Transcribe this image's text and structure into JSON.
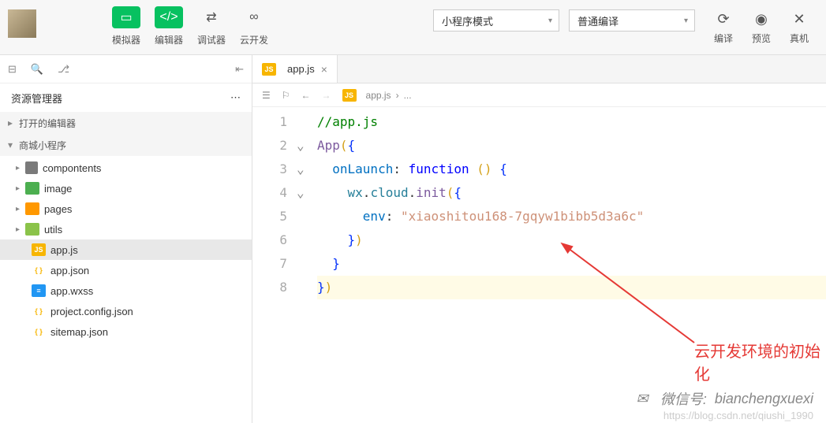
{
  "toolbar": {
    "simulator": "模拟器",
    "editor": "编辑器",
    "debugger": "调试器",
    "cloud": "云开发",
    "mode_dropdown": "小程序模式",
    "compile_dropdown": "普通编译",
    "compile": "编译",
    "preview": "预览",
    "device": "真机"
  },
  "sidebar": {
    "title": "资源管理器",
    "open_editors": "打开的编辑器",
    "project_name": "商城小程序",
    "tree": [
      {
        "name": "compontents",
        "type": "folder",
        "cls": "folder-icon"
      },
      {
        "name": "image",
        "type": "folder",
        "cls": "folder-green"
      },
      {
        "name": "pages",
        "type": "folder",
        "cls": "folder-orange"
      },
      {
        "name": "utils",
        "type": "folder",
        "cls": "folder-lime"
      },
      {
        "name": "app.js",
        "type": "file",
        "cls": "js-icon",
        "txt": "JS",
        "active": true
      },
      {
        "name": "app.json",
        "type": "file",
        "cls": "json-icon",
        "txt": "{ }"
      },
      {
        "name": "app.wxss",
        "type": "file",
        "cls": "wxss-icon",
        "txt": "≡"
      },
      {
        "name": "project.config.json",
        "type": "file",
        "cls": "json-icon",
        "txt": "{ }"
      },
      {
        "name": "sitemap.json",
        "type": "file",
        "cls": "json-icon",
        "txt": "{ }"
      }
    ]
  },
  "editor": {
    "tab_name": "app.js",
    "breadcrumb_file": "app.js",
    "breadcrumb_sep": "›",
    "breadcrumb_more": "...",
    "code_lines": {
      "l1_comment": "//app.js",
      "l2_func": "App",
      "l3_prop": "onLaunch",
      "l3_kw": "function",
      "l4_obj1": "wx",
      "l4_obj2": "cloud",
      "l4_method": "init",
      "l5_prop": "env",
      "l5_str": "\"xiaoshitou168-7gqyw1bibb5d3a6c\""
    }
  },
  "annotation": "云开发环境的初始化",
  "watermark": {
    "label": "微信号:",
    "value": "bianchengxuexi",
    "sub": "https://blog.csdn.net/qiushi_1990"
  },
  "chart_data": null
}
